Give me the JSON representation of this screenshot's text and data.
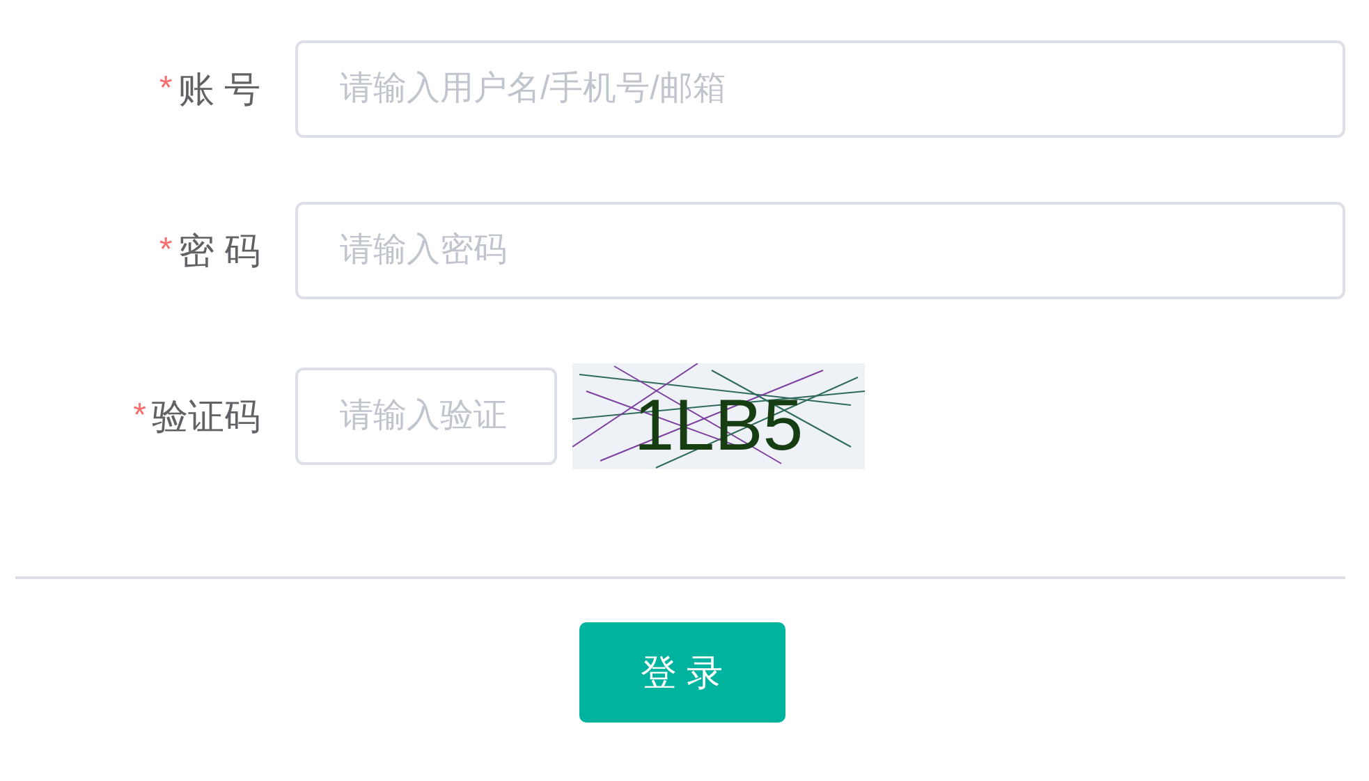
{
  "fields": [
    {
      "required_mark": "*",
      "label": "账 号",
      "placeholder": "请输入用户名/手机号/邮箱"
    },
    {
      "required_mark": "*",
      "label": "密 码",
      "placeholder": "请输入密码"
    }
  ],
  "captcha": {
    "required_mark": "*",
    "label": "验证码",
    "placeholder": "请输入验证",
    "code": "1LB5"
  },
  "submit": {
    "label": "登 录"
  }
}
